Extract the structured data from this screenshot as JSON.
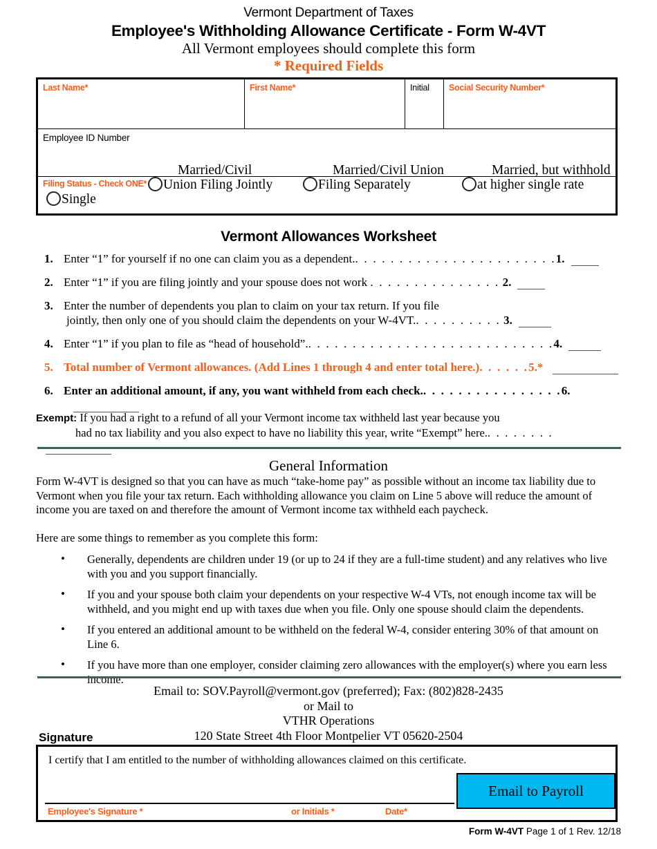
{
  "header": {
    "agency": "Vermont Department of Taxes",
    "title": "Employee's Withholding Allowance Certificate - Form W-4VT",
    "subtitle": "All Vermont employees should complete this form",
    "required_note": "* Required Fields"
  },
  "colors": {
    "required_orange": "#F4601C",
    "divider_green": "#33694B",
    "button_blue": "#00B8F0",
    "rule_black": "#000000"
  },
  "identity_fields": {
    "last_name_label": "Last Name*",
    "first_name_label": "First Name*",
    "initial_label": "Initial",
    "ssn_label": "Social Security Number*",
    "employee_id_label": "Employee ID Number",
    "last_name_value": "",
    "first_name_value": "",
    "initial_value": "",
    "ssn_value": "",
    "employee_id_value": ""
  },
  "filing_status": {
    "label": "Filing Status - Check ONE*",
    "options": [
      {
        "line1": "",
        "line2": "Single",
        "selected": false
      },
      {
        "line1": "Married/Civil",
        "line2": "Union Filing Jointly",
        "selected": false
      },
      {
        "line1": "Married/Civil Union",
        "line2": "Filing Separately",
        "selected": false
      },
      {
        "line1": "Married, but withhold",
        "line2": "at higher single rate",
        "selected": false
      }
    ]
  },
  "worksheet": {
    "title": "Vermont Allowances Worksheet",
    "lines": [
      {
        "num": "1.",
        "text": "Enter “1” for yourself if no one can claim you as a dependent.",
        "dots": ". . . . . . . . . . . . . . . . . . . . . . .",
        "ref": "1.",
        "value": ""
      },
      {
        "num": "2.",
        "text": "Enter “1” if you are filing jointly and your spouse does not work",
        "dots": ". . . . . . . . . . . . . . .",
        "ref": "2.",
        "value": ""
      },
      {
        "num": "3.",
        "text_line1": "Enter the number of dependents you plan to claim on your tax return.  If you file",
        "text_line2": "jointly, then only one of you should claim the dependents on your W-4VT.",
        "dots": ". . . . . . . . . .",
        "ref": "3.",
        "value": ""
      },
      {
        "num": "4.",
        "text": "Enter “1” if you plan to file as “head of household”.",
        "dots": ". . . . . . . . . . . . . . . . . . . . . . . . . . . .",
        "ref": "4.",
        "value": ""
      },
      {
        "num": "5.",
        "text": "Total number of Vermont allowances.  (Add Lines 1 through 4 and enter total here.)",
        "dots": ". . . . . .",
        "ref": "5.*",
        "value": ""
      },
      {
        "num": "6.",
        "text": "Enter an additional amount, if any, you want withheld from each check.",
        "dots": ". . . . . . . . . . . . . . . .",
        "ref": "6.",
        "value": ""
      }
    ],
    "exempt": {
      "label": "Exempt:",
      "line1": "If you had a right to a refund of all your Vermont income tax withheld last year because you",
      "line2": "had no tax liability and you also expect to have no liability this year, write “Exempt” here.",
      "dots": ". . . . . . . .",
      "value": ""
    }
  },
  "general_info": {
    "title": "General Information",
    "paragraph": "Form W-4VT is designed so that you can have as much “take-home pay” as possible without an income tax liability due to Vermont when you file your tax return.  Each withholding allowance you claim on Line 5 above will reduce the amount of income you are taxed on and therefore the amount of Vermont income tax withheld each paycheck.",
    "subheading": "Here are some things to remember as you complete this form:",
    "bullet_glyph": "•",
    "bullets": [
      "Generally, dependents are children under 19 (or up to 24 if they are a full-time student) and any relatives who live with you and you support financially.",
      "If you and your spouse both claim your dependents on your respective W-4 VTs, not enough income tax will be withheld, and you might end up with taxes due when you file. Only one spouse should claim the dependents.",
      "If you entered an additional amount to be withheld on the federal W-4, consider entering 30% of that amount on Line 6.",
      "If you have more than one employer, consider claiming zero allowances with the employer(s) where you earn less income."
    ]
  },
  "contact": {
    "line1": "Email to: SOV.Payroll@vermont.gov (preferred); Fax: (802)828-2435",
    "line2": "or Mail to",
    "line3": "VTHR Operations",
    "line4": "120 State Street 4th Floor Montpelier VT 05620-2504"
  },
  "signature": {
    "section_label": "Signature",
    "certification": "I certify that I am entitled to the number of withholding allowances claimed on this certificate.",
    "signature_field_label": "Employee's Signature *",
    "initials_field_label": "or Initials *",
    "date_field_label": "Date*",
    "signature_value": "",
    "initials_value": "",
    "date_value": "",
    "email_button_label": "Email to Payroll"
  },
  "footer": {
    "form_id": "Form W-4VT",
    "page": "Page 1 of 1",
    "revision": "Rev. 12/18"
  }
}
